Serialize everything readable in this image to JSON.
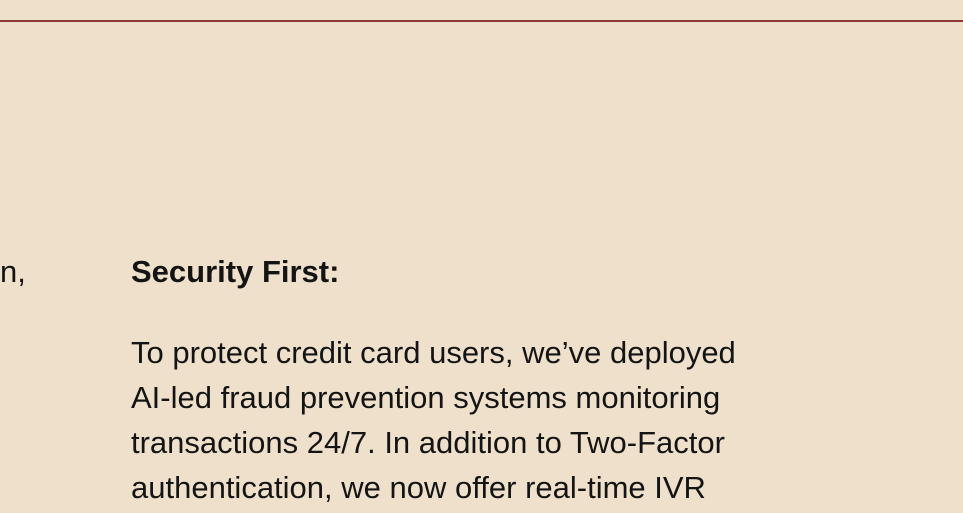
{
  "accent_color": "#8c3a33",
  "background_color": "#efe0cb",
  "left_fragment": "n,",
  "section": {
    "heading": "Security First:",
    "lines": [
      "To protect credit card users, we’ve deployed",
      "AI-led fraud prevention systems monitoring",
      "transactions 24/7. In addition to Two-Factor",
      "authentication, we now offer real-time IVR"
    ]
  }
}
